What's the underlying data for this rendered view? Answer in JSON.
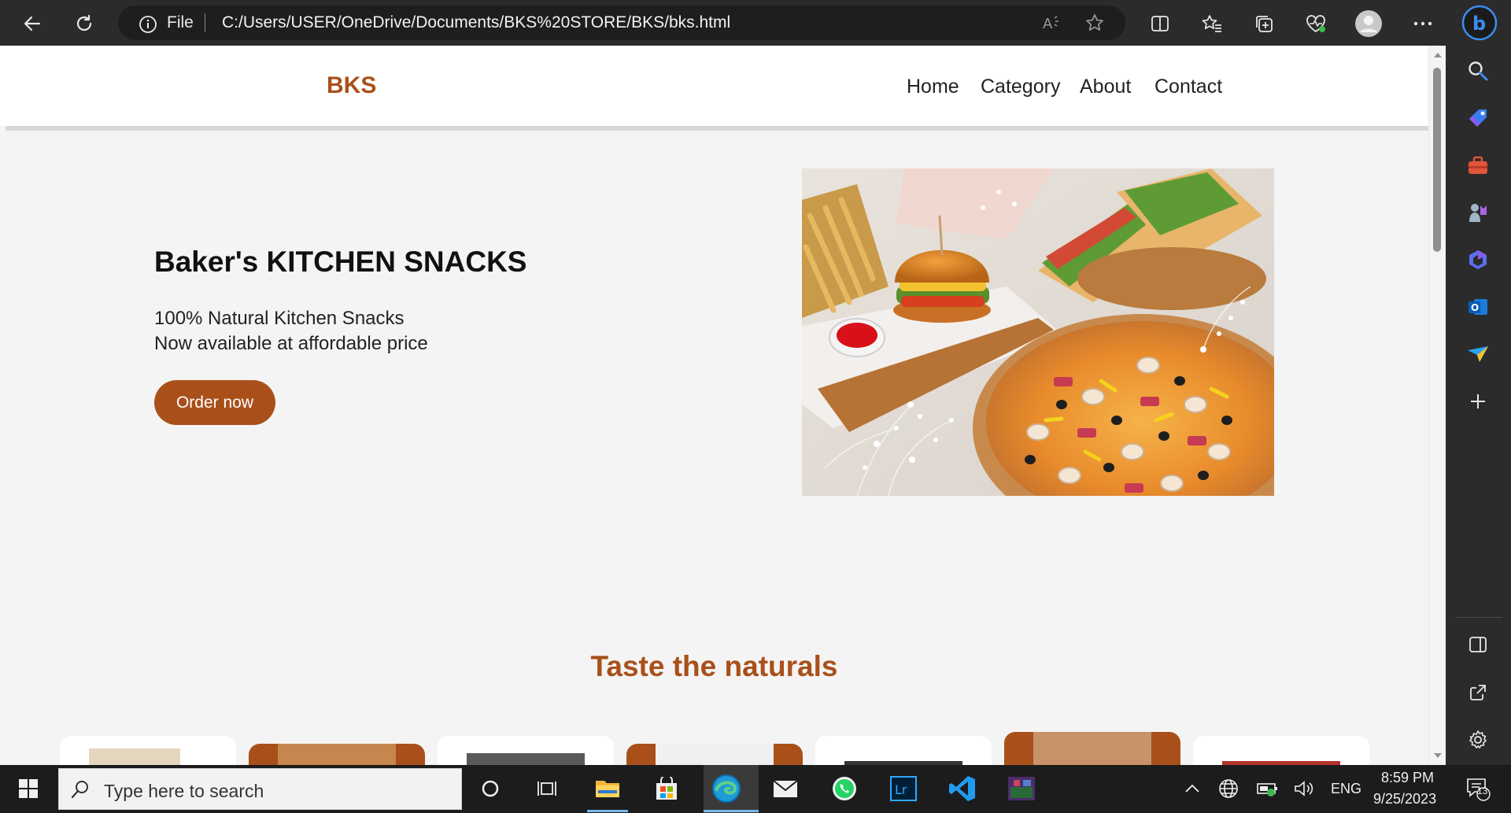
{
  "browser": {
    "address_file_label": "File",
    "url": "C:/Users/USER/OneDrive/Documents/BKS%20STORE/BKS/bks.html"
  },
  "site": {
    "brand": "BKS",
    "nav": [
      "Home",
      "Category",
      "About",
      "Contact"
    ],
    "hero": {
      "title": "Baker's KITCHEN SNACKS",
      "line1": "100% Natural Kitchen Snacks",
      "line2": "Now available at affordable price",
      "cta": "Order now",
      "image_alt": "burger-sandwich-pizza-photo"
    },
    "section_title": "Taste the naturals"
  },
  "taskbar": {
    "search_placeholder": "Type here to search",
    "language": "ENG",
    "time": "8:59 PM",
    "date": "9/25/2023",
    "notification_count": "13"
  },
  "colors": {
    "brand": "#a9501a",
    "page_bg": "#f4f4f4",
    "chrome_bg": "#2b2b2b",
    "taskbar_bg": "#1c1c1c"
  },
  "icons": {
    "toolbar": [
      "back-icon",
      "refresh-icon",
      "info-icon",
      "read-aloud-icon",
      "favorite-star-icon",
      "split-screen-icon",
      "favorites-icon",
      "collections-icon",
      "browser-essentials-icon",
      "profile-icon",
      "more-icon",
      "bing-icon"
    ],
    "sidebar": [
      "search-icon",
      "shopping-tag-icon",
      "tools-icon",
      "games-icon",
      "copilot-icon",
      "outlook-icon",
      "send-icon",
      "add-icon",
      "hide-sidebar-icon",
      "external-link-icon",
      "settings-icon"
    ]
  }
}
